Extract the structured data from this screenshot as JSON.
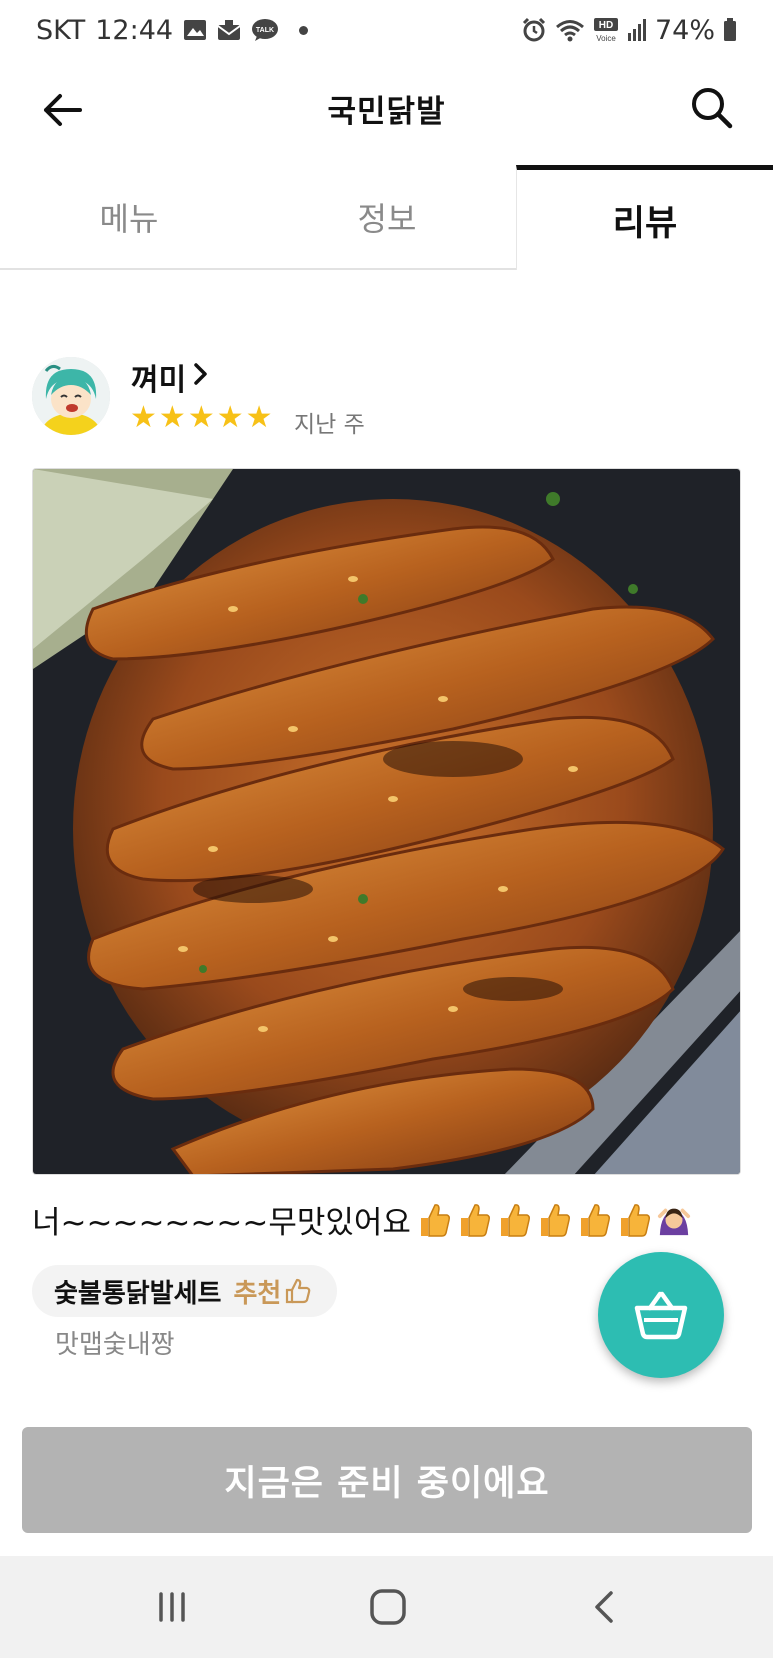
{
  "status_bar": {
    "carrier": "SKT",
    "time": "12:44",
    "battery": "74%",
    "icons_left": [
      "image-icon",
      "mail-icon",
      "talk-icon"
    ],
    "icons_right": [
      "alarm-icon",
      "wifi-icon",
      "hd-voice-icon",
      "signal-icon",
      "battery-icon"
    ],
    "hd_label": "HD",
    "voice_label": "Voice",
    "talk_label": "TALK"
  },
  "header": {
    "title": "국민닭발",
    "back_icon": "arrow-left-icon",
    "search_icon": "search-icon"
  },
  "tabs": [
    {
      "label": "메뉴",
      "active": false
    },
    {
      "label": "정보",
      "active": false
    },
    {
      "label": "리뷰",
      "active": true
    }
  ],
  "review": {
    "author": "껴미",
    "author_chevron": ">",
    "rating": 5,
    "star_char": "★",
    "date": "지난 주",
    "text": "너~~~~~~~~무맛있어요",
    "thumbs_count": 6,
    "menu_chip": {
      "name": "숯불통닭발세트",
      "recommend": "추천"
    },
    "menu_sub": "맛맵숯내짱"
  },
  "cta": {
    "label": "지금은 준비 중이에요"
  },
  "colors": {
    "accent_teal": "#2dbdb2",
    "star": "#f7c117",
    "recommend": "#c99858",
    "cta_disabled": "#b3b3b3"
  }
}
